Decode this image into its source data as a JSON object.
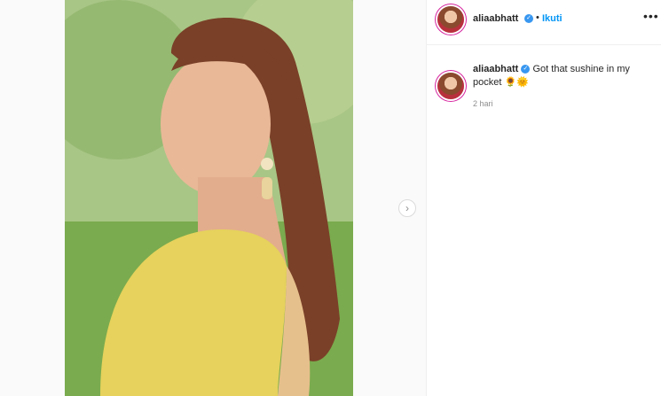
{
  "post": {
    "username": "aliaabhatt",
    "follow_label": "Ikuti",
    "caption": "Got that sushine in my pocket 🌻🌞",
    "timestamp": "2 hari"
  },
  "colors": {
    "accent": "#0095f6",
    "verified": "#3897f0",
    "ring": "#d6249f"
  },
  "icons": {
    "verified": "verified-badge-icon",
    "more": "more-options-icon",
    "next": "chevron-right-icon"
  }
}
